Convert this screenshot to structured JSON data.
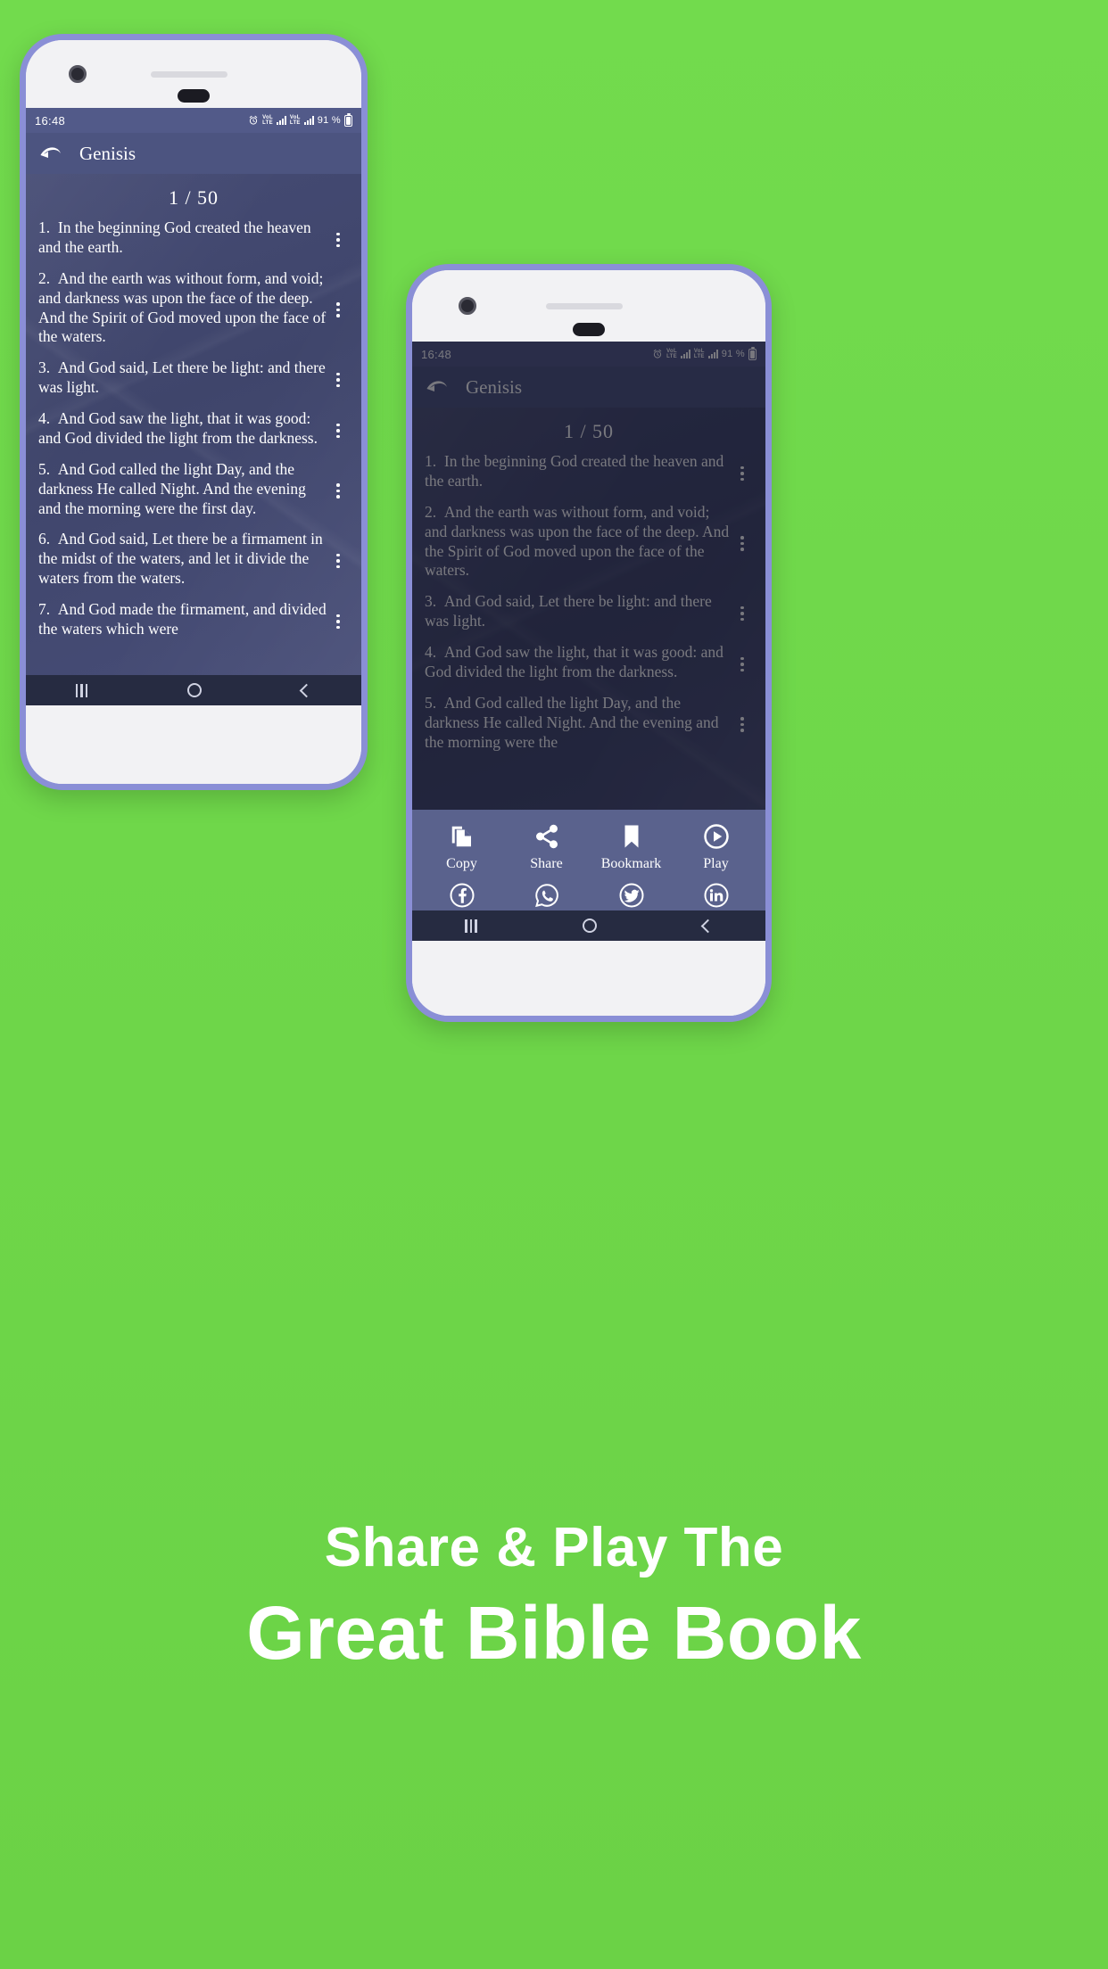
{
  "background_color": "#6ed649",
  "caption": {
    "line1": "Share & Play The",
    "line2": "Great Bible Book"
  },
  "phone1": {
    "status_bar": {
      "time": "16:48",
      "battery": "91 %",
      "network": "VoLTE",
      "alarm_icon": "alarm-icon"
    },
    "app_bar": {
      "back_icon": "back-arrow-icon",
      "title": "Genisis"
    },
    "chapter_counter": "1 / 50",
    "verses": [
      {
        "num": "1.",
        "text": "In the beginning God created the heaven and the earth."
      },
      {
        "num": "2.",
        "text": "And the earth was without form, and void; and darkness was upon the face of the deep. And the Spirit of God moved upon the face of the waters."
      },
      {
        "num": "3.",
        "text": "And God said, Let there be light: and there was light."
      },
      {
        "num": "4.",
        "text": "And God saw the light, that it was good: and God divided the light from the darkness."
      },
      {
        "num": "5.",
        "text": "And God called the light Day, and the darkness He called Night. And the evening and the morning were the first day."
      },
      {
        "num": "6.",
        "text": "And God said, Let there be a firmament in the midst of the waters, and let it divide the waters from the waters."
      },
      {
        "num": "7.",
        "text": "And God made the firmament, and divided the waters which were"
      }
    ],
    "nav_bar": {
      "recents": "recents-icon",
      "home": "home-icon",
      "back": "back-icon"
    }
  },
  "phone2": {
    "status_bar": {
      "time": "16:48",
      "battery": "91 %",
      "network": "VoLTE",
      "alarm_icon": "alarm-icon"
    },
    "app_bar": {
      "back_icon": "back-arrow-icon",
      "title": "Genisis"
    },
    "chapter_counter": "1 / 50",
    "verses": [
      {
        "num": "1.",
        "text": "In the beginning God created the heaven and the earth."
      },
      {
        "num": "2.",
        "text": "And the earth was without form, and void; and darkness was upon the face of the deep. And the Spirit of God moved upon the face of the waters."
      },
      {
        "num": "3.",
        "text": "And God said, Let there be light: and there was light."
      },
      {
        "num": "4.",
        "text": "And God saw the light, that it was good: and God divided the light from the darkness."
      },
      {
        "num": "5.",
        "text": "And God called the light Day, and the darkness He called Night. And the evening and the morning were the"
      }
    ],
    "share_sheet": {
      "row1": [
        {
          "icon": "copy-icon",
          "label": "Copy"
        },
        {
          "icon": "share-icon",
          "label": "Share"
        },
        {
          "icon": "bookmark-icon",
          "label": "Bookmark"
        },
        {
          "icon": "play-icon",
          "label": "Play"
        }
      ],
      "row2": [
        {
          "icon": "facebook-icon",
          "label": "Facebook"
        },
        {
          "icon": "whatsapp-icon",
          "label": "WhatsApp"
        },
        {
          "icon": "twitter-icon",
          "label": "Twitter"
        },
        {
          "icon": "linkedin-icon",
          "label": "LinkedIn"
        }
      ]
    },
    "nav_bar": {
      "recents": "recents-icon",
      "home": "home-icon",
      "back": "back-icon"
    }
  }
}
